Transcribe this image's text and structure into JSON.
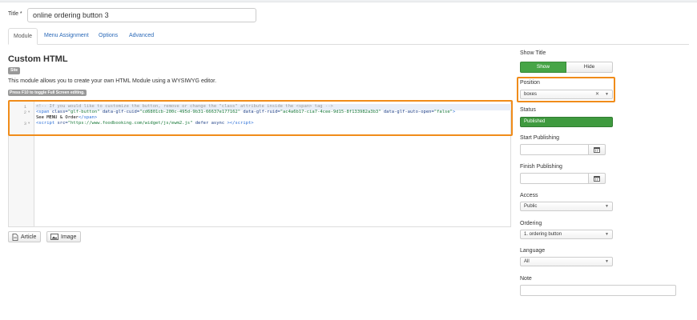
{
  "form": {
    "title_label": "Title *",
    "title_value": "online ordering button 3"
  },
  "tabs": [
    {
      "label": "Module"
    },
    {
      "label": "Menu Assignment"
    },
    {
      "label": "Options"
    },
    {
      "label": "Advanced"
    }
  ],
  "module": {
    "heading": "Custom HTML",
    "badge": "Site",
    "description": "This module allows you to create your own HTML Module using a WYSIWYG editor.",
    "fullscreen_hint": "Press F10 to toggle Full Screen editing."
  },
  "editor": {
    "line_numbers": [
      "1",
      "2",
      "3"
    ],
    "buttons": {
      "article": "Article",
      "image": "Image"
    }
  },
  "sidebar": {
    "show_title": {
      "label": "Show Title",
      "show": "Show",
      "hide": "Hide"
    },
    "position": {
      "label": "Position",
      "value": "boxes"
    },
    "status": {
      "label": "Status",
      "value": "Published"
    },
    "start_publishing": {
      "label": "Start Publishing"
    },
    "finish_publishing": {
      "label": "Finish Publishing"
    },
    "access": {
      "label": "Access",
      "value": "Public"
    },
    "ordering": {
      "label": "Ordering",
      "value": "1. ordering button"
    },
    "language": {
      "label": "Language",
      "value": "All"
    },
    "note": {
      "label": "Note"
    }
  },
  "colors": {
    "accent_link": "#2a69b8",
    "success_green": "#46a546",
    "highlight_orange": "#f08c1a"
  }
}
